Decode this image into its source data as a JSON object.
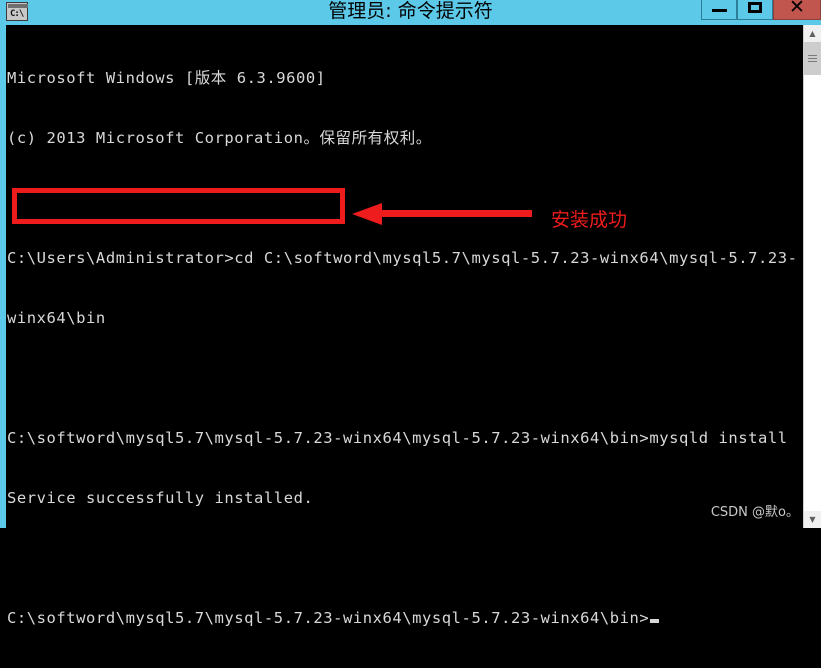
{
  "window": {
    "title": "管理员: 命令提示符",
    "icon_name": "cmd-icon",
    "icon_glyph": "C:\\",
    "buttons": {
      "minimize_label": "—",
      "maximize_label": "❐",
      "close_label": "✕"
    },
    "colors": {
      "titlebar": "#5CC9E8",
      "close_button": "#c0564d",
      "console_background": "#000000",
      "console_text": "#d8d8d8",
      "annotation_red": "#ee1c1c"
    }
  },
  "console": {
    "lines": [
      "Microsoft Windows [版本 6.3.9600]",
      "(c) 2013 Microsoft Corporation。保留所有权利。",
      "",
      "C:\\Users\\Administrator>cd C:\\softword\\mysql5.7\\mysql-5.7.23-winx64\\mysql-5.7.23-",
      "winx64\\bin",
      "",
      "C:\\softword\\mysql5.7\\mysql-5.7.23-winx64\\mysql-5.7.23-winx64\\bin>mysqld install",
      "Service successfully installed.",
      "",
      "C:\\softword\\mysql5.7\\mysql-5.7.23-winx64\\mysql-5.7.23-winx64\\bin>"
    ],
    "cursor_visible": true
  },
  "annotations": {
    "highlight_target": "Service successfully installed.",
    "arrow_direction": "left",
    "label": "安装成功"
  },
  "scrollbar": {
    "up_arrow": "▲",
    "down_arrow": "▼"
  },
  "watermark": "CSDN @默o。"
}
